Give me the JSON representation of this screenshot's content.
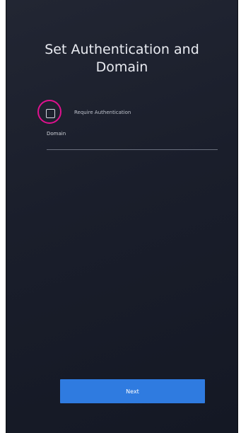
{
  "screen": {
    "title_line1": "Set Authentication and",
    "title_line2": "Domain"
  },
  "auth": {
    "checkbox_label": "Require Authentication",
    "checked": false
  },
  "domain": {
    "label": "Domain",
    "value": "",
    "placeholder": ""
  },
  "footer": {
    "next_label": "Next"
  },
  "colors": {
    "background": "#1a1e2b",
    "accent": "#2f7be0",
    "highlight": "#e0118f"
  }
}
